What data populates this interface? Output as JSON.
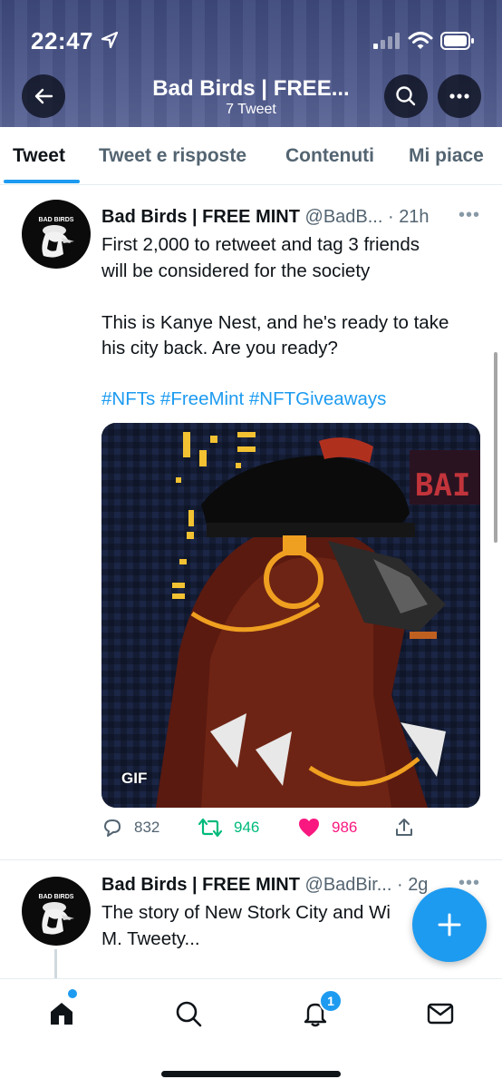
{
  "status_bar": {
    "time": "22:47"
  },
  "header": {
    "title": "Bad Birds | FREE...",
    "subtitle": "7 Tweet"
  },
  "tabs": [
    {
      "label": "Tweet",
      "active": true
    },
    {
      "label": "Tweet e risposte",
      "active": false
    },
    {
      "label": "Contenuti",
      "active": false
    },
    {
      "label": "Mi piace",
      "active": false
    }
  ],
  "tweets": [
    {
      "avatar_text": "BAD BIRDS",
      "name": "Bad Birds | FREE MINT",
      "handle_time": "@BadB... · 21h",
      "lines": [
        "First 2,000 to retweet and tag 3 friends",
        "will be considered for the society",
        "",
        "This is Kanye Nest, and he's ready to take",
        "his city back. Are you ready?"
      ],
      "hashtags": "#NFTs #FreeMint #NFTGiveaways",
      "media_badge": "GIF",
      "media_sign_text": "BAI",
      "replies": "832",
      "retweets": "946",
      "likes": "986"
    },
    {
      "avatar_text": "BAD BIRDS",
      "name": "Bad Birds | FREE MINT",
      "handle_time": "@BadBir... · 2g",
      "lines": [
        "The story of New Stork City and Wi",
        "M. Tweety..."
      ]
    }
  ],
  "bottom_nav": {
    "notifications_badge": "1"
  },
  "colors": {
    "accent": "#1d9bf0",
    "retweet": "#00ba7c",
    "like": "#f91880",
    "header_bg": "#4a5588"
  }
}
